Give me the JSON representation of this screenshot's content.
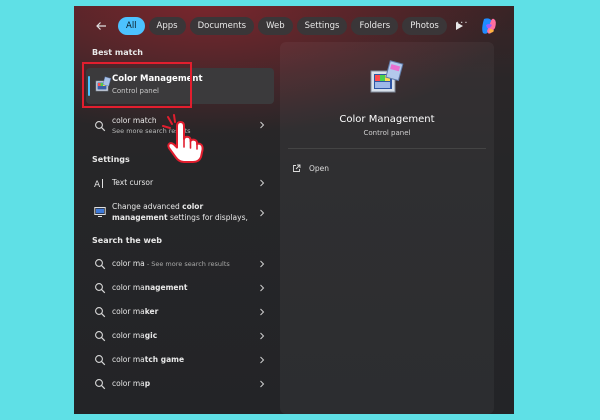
{
  "filters": {
    "all": "All",
    "apps": "Apps",
    "documents": "Documents",
    "web": "Web",
    "settings": "Settings",
    "folders": "Folders",
    "photos": "Photos",
    "more": "···"
  },
  "left": {
    "best_match_title": "Best match",
    "best_match": {
      "title": "Color Management",
      "subtitle": "Control panel"
    },
    "color_match": {
      "title": "color match",
      "subtitle": "See more search results"
    },
    "settings_title": "Settings",
    "text_cursor": "Text cursor",
    "advanced_color": {
      "line1_pre": "Change advanced ",
      "line1_bold": "color",
      "line2_bold": "management",
      "line2_rest": " settings for displays,"
    },
    "web_title": "Search the web",
    "web_results": [
      {
        "pre": "color ma",
        "bold": "",
        "suffix": " - See more search results"
      },
      {
        "pre": "color ma",
        "bold": "nagement",
        "suffix": ""
      },
      {
        "pre": "color ma",
        "bold": "ker",
        "suffix": ""
      },
      {
        "pre": "color ma",
        "bold": "gic",
        "suffix": ""
      },
      {
        "pre": "color ma",
        "bold": "tch game",
        "suffix": ""
      },
      {
        "pre": "color ma",
        "bold": "p",
        "suffix": ""
      }
    ]
  },
  "right": {
    "title": "Color Management",
    "subtitle": "Control panel",
    "open_label": "Open"
  },
  "colors": {
    "accent": "#4cc2ff",
    "highlight_border": "#e21e2e",
    "page_bg": "#5fe0e6"
  }
}
